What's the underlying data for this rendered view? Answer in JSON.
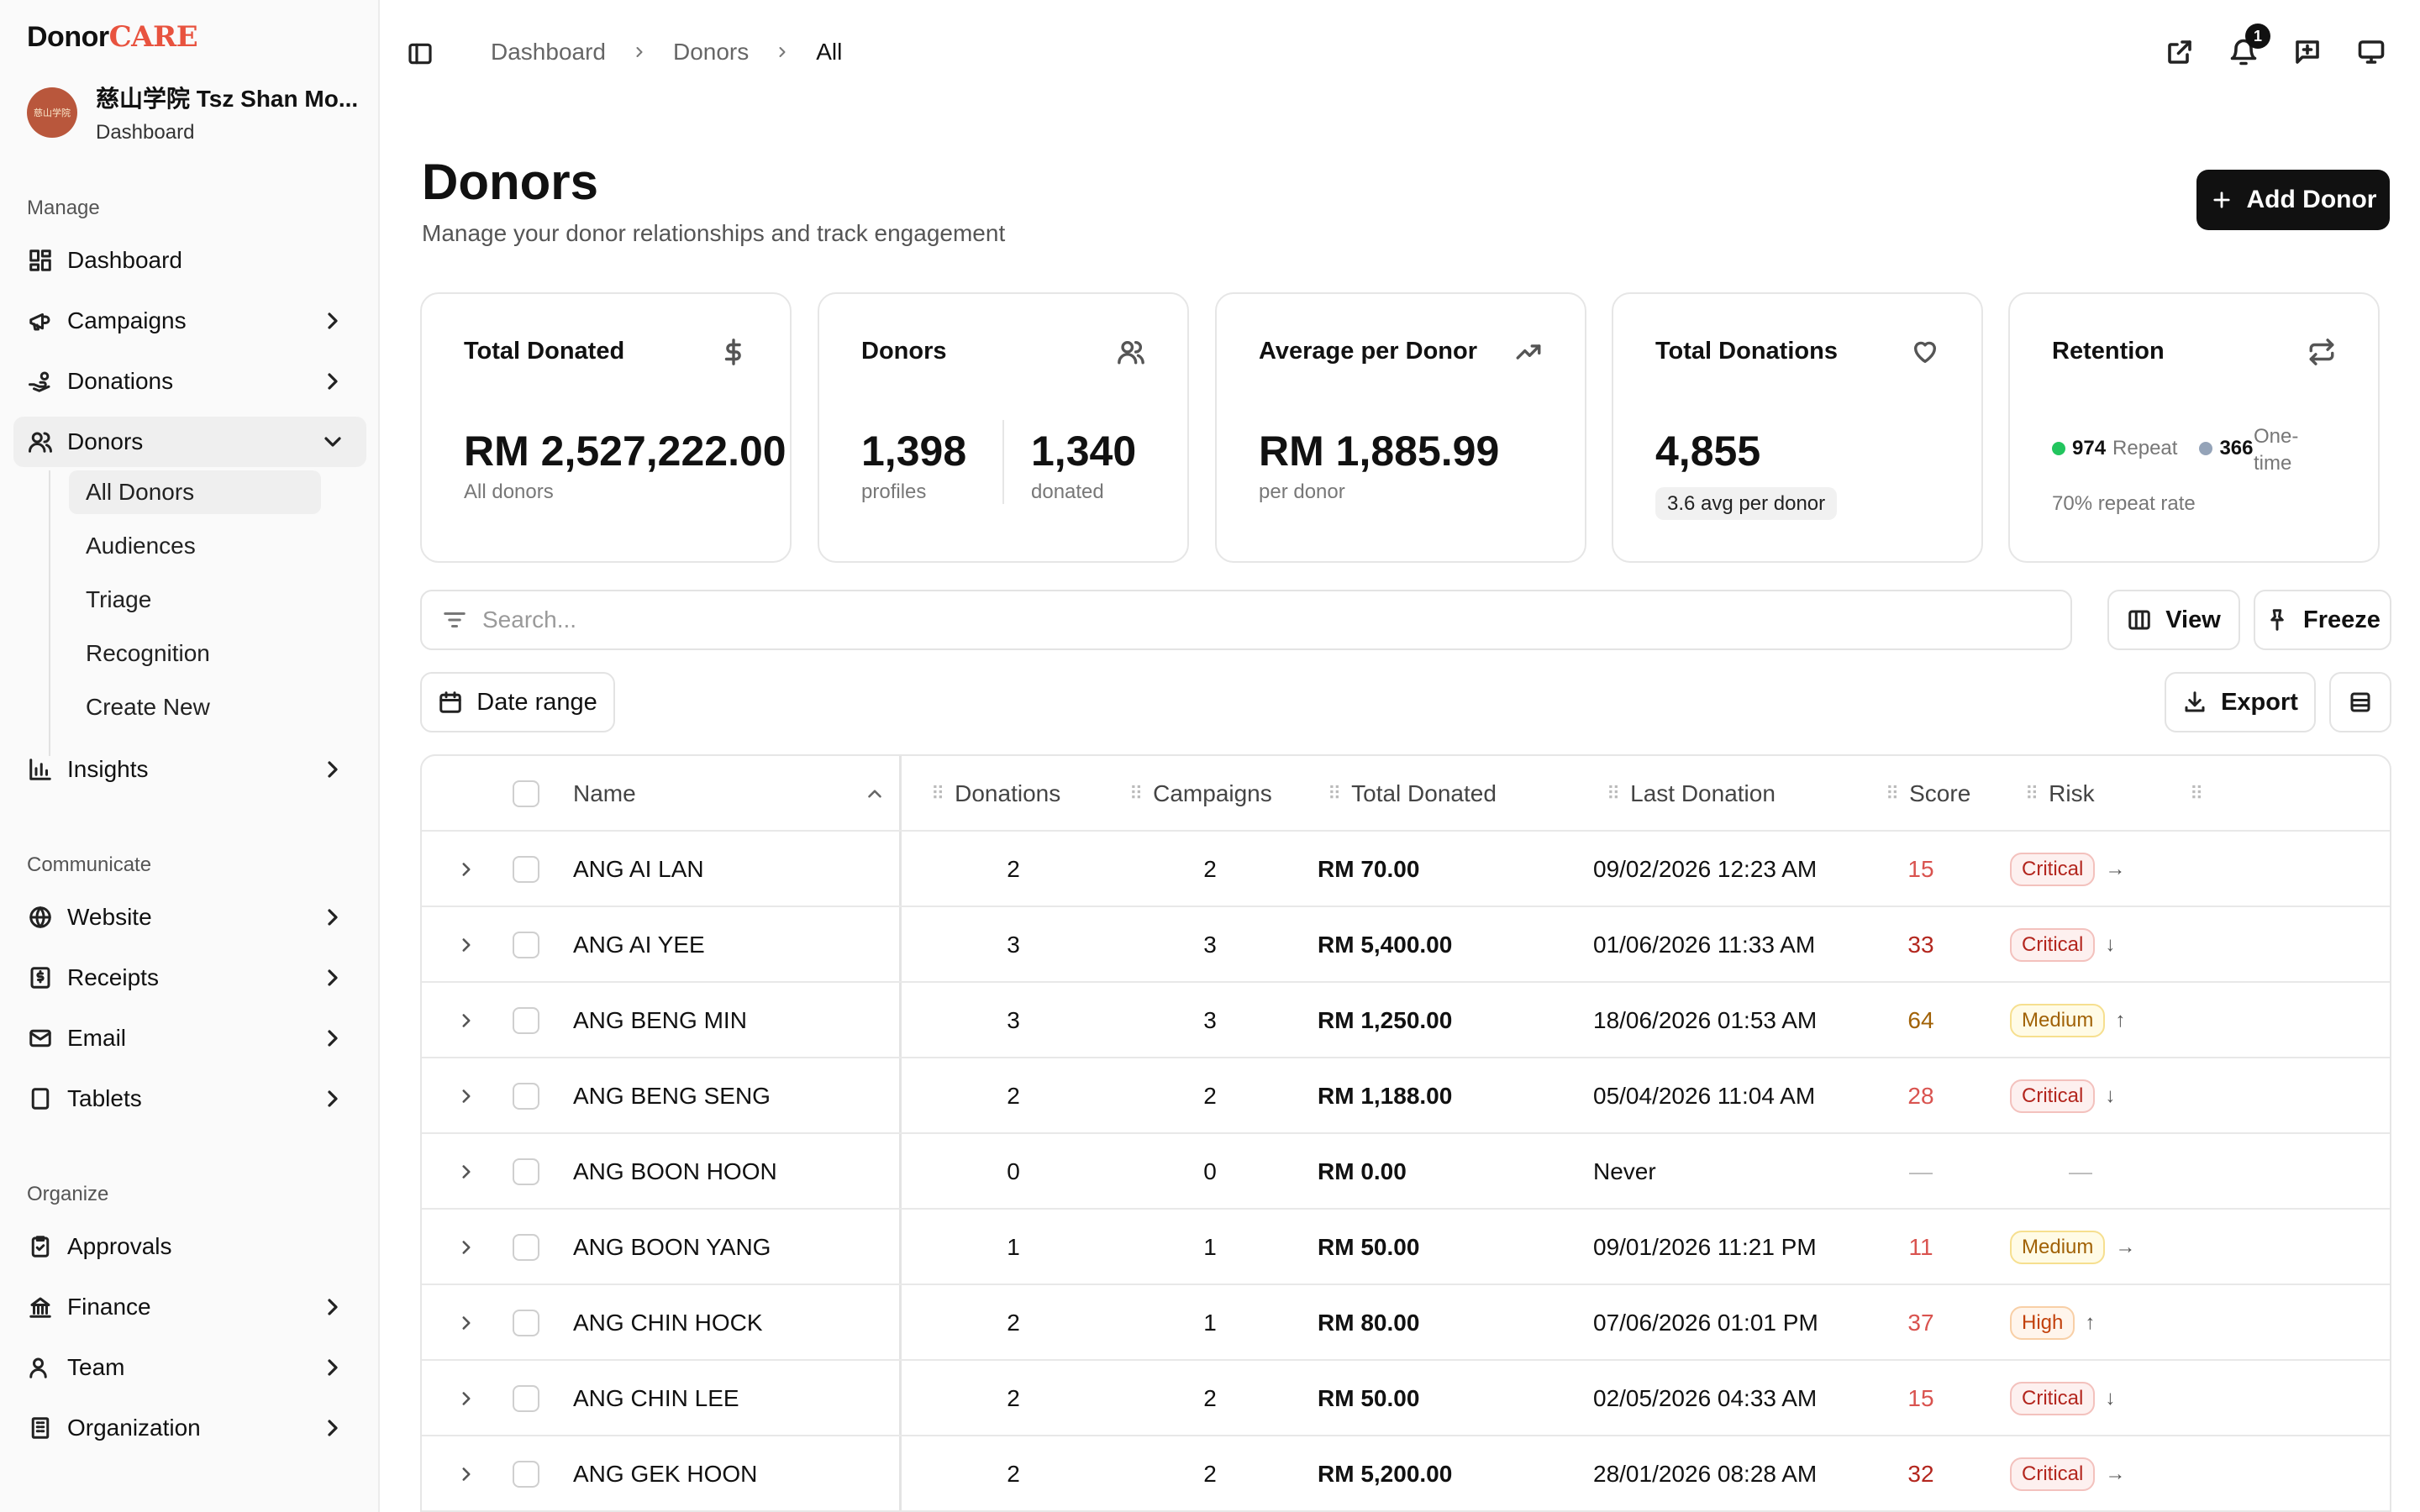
{
  "brand": {
    "part1": "Donor",
    "part2": "CARE"
  },
  "org": {
    "avatar_text": "慈山学院",
    "name": "慈山学院 Tsz Shan Mo...",
    "sub": "Dashboard"
  },
  "sidebar": {
    "sections": {
      "manage": "Manage",
      "communicate": "Communicate",
      "organize": "Organize"
    },
    "items": {
      "dashboard": "Dashboard",
      "campaigns": "Campaigns",
      "donations": "Donations",
      "donors": "Donors",
      "insights": "Insights",
      "website": "Website",
      "receipts": "Receipts",
      "email": "Email",
      "tablets": "Tablets",
      "approvals": "Approvals",
      "finance": "Finance",
      "team": "Team",
      "organization": "Organization"
    },
    "donors_sub": [
      "All Donors",
      "Audiences",
      "Triage",
      "Recognition",
      "Create New"
    ]
  },
  "breadcrumb": [
    "Dashboard",
    "Donors",
    "All"
  ],
  "notifications_count": "1",
  "header": {
    "title": "Donors",
    "subtitle": "Manage your donor relationships and track engagement",
    "add_button": "Add Donor"
  },
  "stats": {
    "total_donated": {
      "title": "Total Donated",
      "value": "RM 2,527,222.00",
      "sub": "All donors"
    },
    "donors": {
      "title": "Donors",
      "profiles": "1,398",
      "profiles_label": "profiles",
      "donated": "1,340",
      "donated_label": "donated"
    },
    "average": {
      "title": "Average per Donor",
      "value": "RM 1,885.99",
      "sub": "per donor"
    },
    "total_donations": {
      "title": "Total Donations",
      "value": "4,855",
      "sub": "3.6 avg per donor"
    },
    "retention": {
      "title": "Retention",
      "repeat_count": "974",
      "repeat_label": "Repeat",
      "onetime_count": "366",
      "onetime_label_1": "One-",
      "onetime_label_2": "time",
      "rate": "70% repeat rate",
      "repeat_color": "#22c55e",
      "onetime_color": "#94a3b8"
    }
  },
  "toolbar": {
    "search_placeholder": "Search...",
    "view": "View",
    "freeze": "Freeze",
    "date_range": "Date range",
    "export": "Export"
  },
  "table": {
    "columns": {
      "name": "Name",
      "donations": "Donations",
      "campaigns": "Campaigns",
      "total": "Total Donated",
      "last": "Last Donation",
      "score": "Score",
      "risk": "Risk"
    },
    "rows": [
      {
        "name": "ANG AI LAN",
        "donations": "2",
        "campaigns": "2",
        "total": "RM 70.00",
        "last": "09/02/2026 12:23 AM",
        "score": "15",
        "risk": "Critical",
        "trend": "→"
      },
      {
        "name": "ANG AI YEE",
        "donations": "3",
        "campaigns": "3",
        "total": "RM 5,400.00",
        "last": "01/06/2026 11:33 AM",
        "score": "33",
        "risk": "Critical",
        "trend": "↓"
      },
      {
        "name": "ANG BENG MIN",
        "donations": "3",
        "campaigns": "3",
        "total": "RM 1,250.00",
        "last": "18/06/2026 01:53 AM",
        "score": "64",
        "risk": "Medium",
        "trend": "↑"
      },
      {
        "name": "ANG BENG SENG",
        "donations": "2",
        "campaigns": "2",
        "total": "RM 1,188.00",
        "last": "05/04/2026 11:04 AM",
        "score": "28",
        "risk": "Critical",
        "trend": "↓"
      },
      {
        "name": "ANG BOON HOON",
        "donations": "0",
        "campaigns": "0",
        "total": "RM 0.00",
        "last": "Never",
        "score": "—",
        "risk": "",
        "trend": "—"
      },
      {
        "name": "ANG BOON YANG",
        "donations": "1",
        "campaigns": "1",
        "total": "RM 50.00",
        "last": "09/01/2026 11:21 PM",
        "score": "11",
        "risk": "Medium",
        "trend": "→"
      },
      {
        "name": "ANG CHIN HOCK",
        "donations": "2",
        "campaigns": "1",
        "total": "RM 80.00",
        "last": "07/06/2026 01:01 PM",
        "score": "37",
        "risk": "High",
        "trend": "↑"
      },
      {
        "name": "ANG CHIN LEE",
        "donations": "2",
        "campaigns": "2",
        "total": "RM 50.00",
        "last": "02/05/2026 04:33 AM",
        "score": "15",
        "risk": "Critical",
        "trend": "↓"
      },
      {
        "name": "ANG GEK HOON",
        "donations": "2",
        "campaigns": "2",
        "total": "RM 5,200.00",
        "last": "28/01/2026 08:28 AM",
        "score": "32",
        "risk": "Critical",
        "trend": "→"
      }
    ]
  },
  "colors": {
    "critical": "#b3261e",
    "medium": "#a16207",
    "high": "#c2410c",
    "score_red": "#d9534f",
    "score_darkred": "#b3261e",
    "score_amber": "#a16207"
  }
}
